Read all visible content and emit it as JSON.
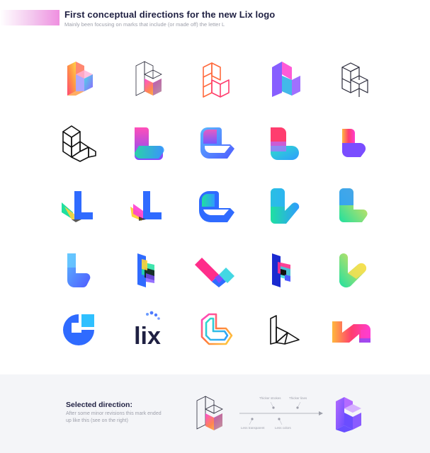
{
  "header": {
    "title": "First conceptual directions for the new Lix logo",
    "subtitle": "Mainly been focusing on marks that include (or made off) the letter L"
  },
  "logo_grid": {
    "rows": 5,
    "columns": 5,
    "wordmark_text": "lix"
  },
  "selected": {
    "title": "Selected direction:",
    "description": "After some minor revisions this mark ended up like this (see on the right)",
    "revisions": [
      {
        "label": "Thicker strokes"
      },
      {
        "label": "Thicker lines"
      },
      {
        "label": "Less transparent"
      },
      {
        "label": "Less colors"
      }
    ]
  },
  "colors": {
    "navy": "#1f2042",
    "purple": "#7a4dff",
    "blue": "#2f6bff",
    "green": "#1fe0a0",
    "pink": "#ff2d8a",
    "orange": "#ff7a3d",
    "footer_bg": "#f4f5f8"
  }
}
